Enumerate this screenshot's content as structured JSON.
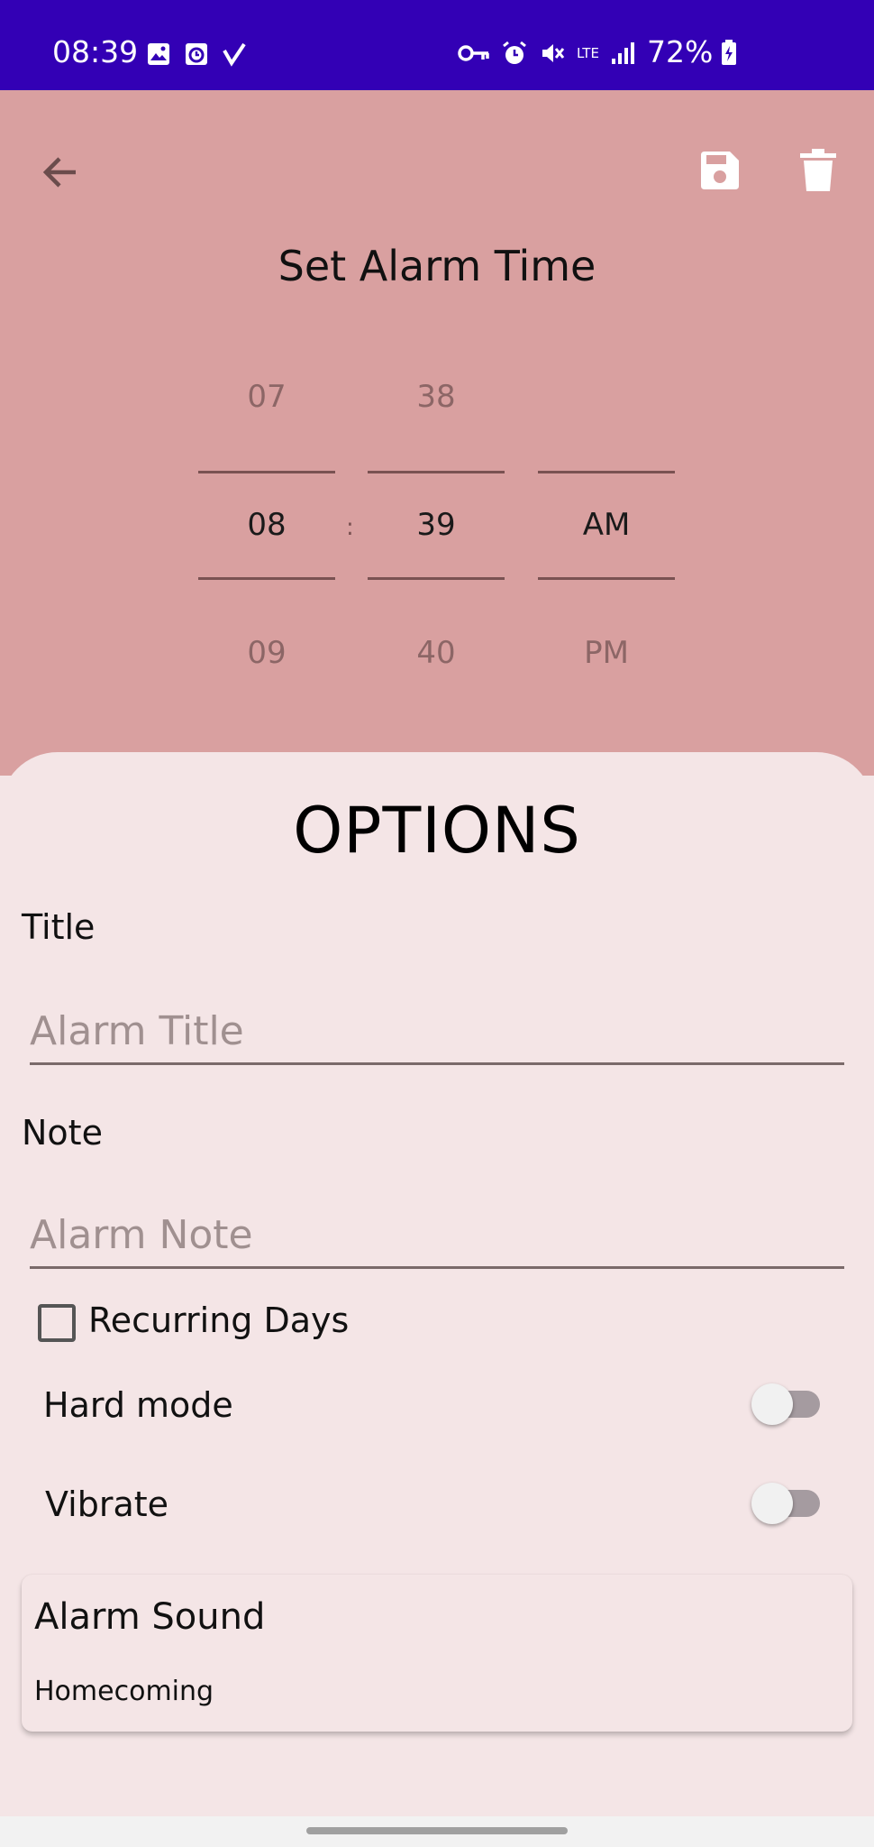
{
  "status_bar": {
    "time": "08:39",
    "battery": "72%",
    "network": "LTE",
    "icons_left": [
      "image-icon",
      "alarm-app-icon",
      "check-icon"
    ],
    "icons_right": [
      "key-icon",
      "alarm-icon",
      "mute-icon",
      "lte-icon",
      "signal-icon"
    ]
  },
  "toolbar": {
    "back_icon": "back-arrow-icon",
    "save_icon": "save-icon",
    "delete_icon": "delete-icon"
  },
  "header": {
    "title": "Set Alarm Time"
  },
  "time_picker": {
    "hour": {
      "prev": "07",
      "current": "08",
      "next": "09"
    },
    "minute": {
      "prev": "38",
      "current": "39",
      "next": "40"
    },
    "ampm": {
      "prev": "",
      "current": "AM",
      "next": "PM"
    },
    "separator": ":"
  },
  "options": {
    "title": "OPTIONS",
    "title_label": "Title",
    "title_placeholder": "Alarm Title",
    "title_value": "",
    "note_label": "Note",
    "note_placeholder": "Alarm Note",
    "note_value": "",
    "recurring_label": "Recurring Days",
    "recurring_checked": false,
    "hard_mode_label": "Hard mode",
    "hard_mode_on": false,
    "vibrate_label": "Vibrate",
    "vibrate_on": false,
    "sound_label": "Alarm Sound",
    "sound_value": "Homecoming"
  },
  "colors": {
    "status_bar": "#3300b5",
    "top_background": "#d9a0a0",
    "sheet_background": "#f4e5e6",
    "picker_line": "#7a5252"
  }
}
